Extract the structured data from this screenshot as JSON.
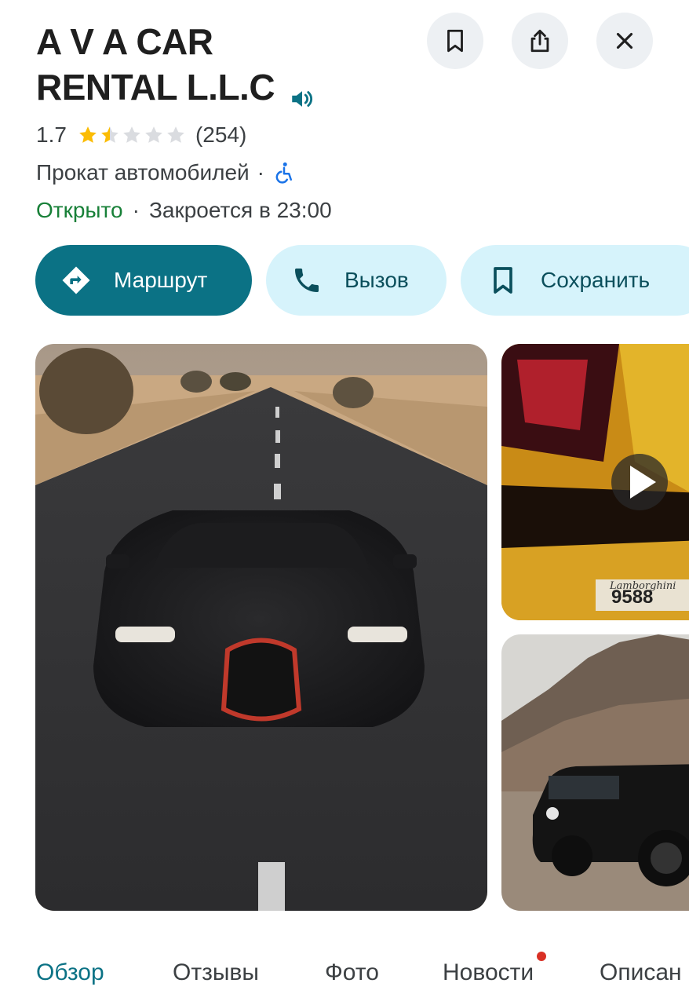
{
  "place": {
    "name_line1": "A V A CAR",
    "name_line2": "RENTAL L.L.C",
    "rating": "1.7",
    "rating_value": 1.7,
    "rating_max": 5,
    "reviews_count": "(254)",
    "category": "Прокат автомобилей",
    "separator": "·",
    "status_open": "Открыто",
    "closes_text": "Закроется в 23:00"
  },
  "header_icons": [
    "speaker-icon",
    "bookmark-icon",
    "share-icon",
    "close-icon",
    "wheelchair-icon"
  ],
  "actions": {
    "directions_label": "Маршрут",
    "call_label": "Вызов",
    "save_label": "Сохранить"
  },
  "photos": {
    "video_plate_text": "9588",
    "video_brand_text": "Lamborghini"
  },
  "tabs": {
    "overview": "Обзор",
    "reviews": "Отзывы",
    "photos": "Фото",
    "news": "Новости",
    "about": "Описан"
  },
  "colors": {
    "accent": "#0b7285",
    "chip_bg": "#d6f3fb",
    "open_green": "#188038",
    "star": "#fbbc04",
    "notification_dot": "#d93025"
  }
}
